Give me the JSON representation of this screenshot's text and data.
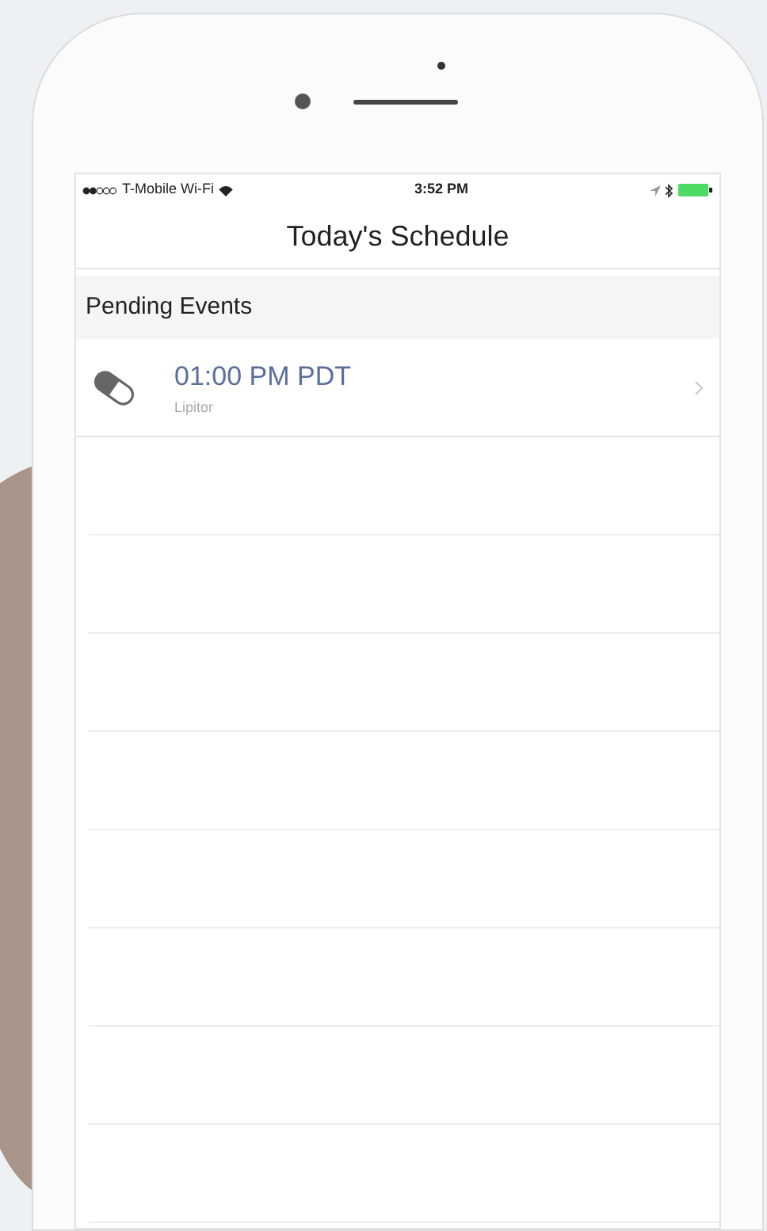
{
  "status_bar": {
    "carrier": "T-Mobile Wi-Fi",
    "time": "3:52 PM"
  },
  "nav": {
    "title": "Today's Schedule"
  },
  "section": {
    "title": "Pending Events"
  },
  "events": [
    {
      "time": "01:00 PM PDT",
      "name": "Lipitor"
    }
  ]
}
